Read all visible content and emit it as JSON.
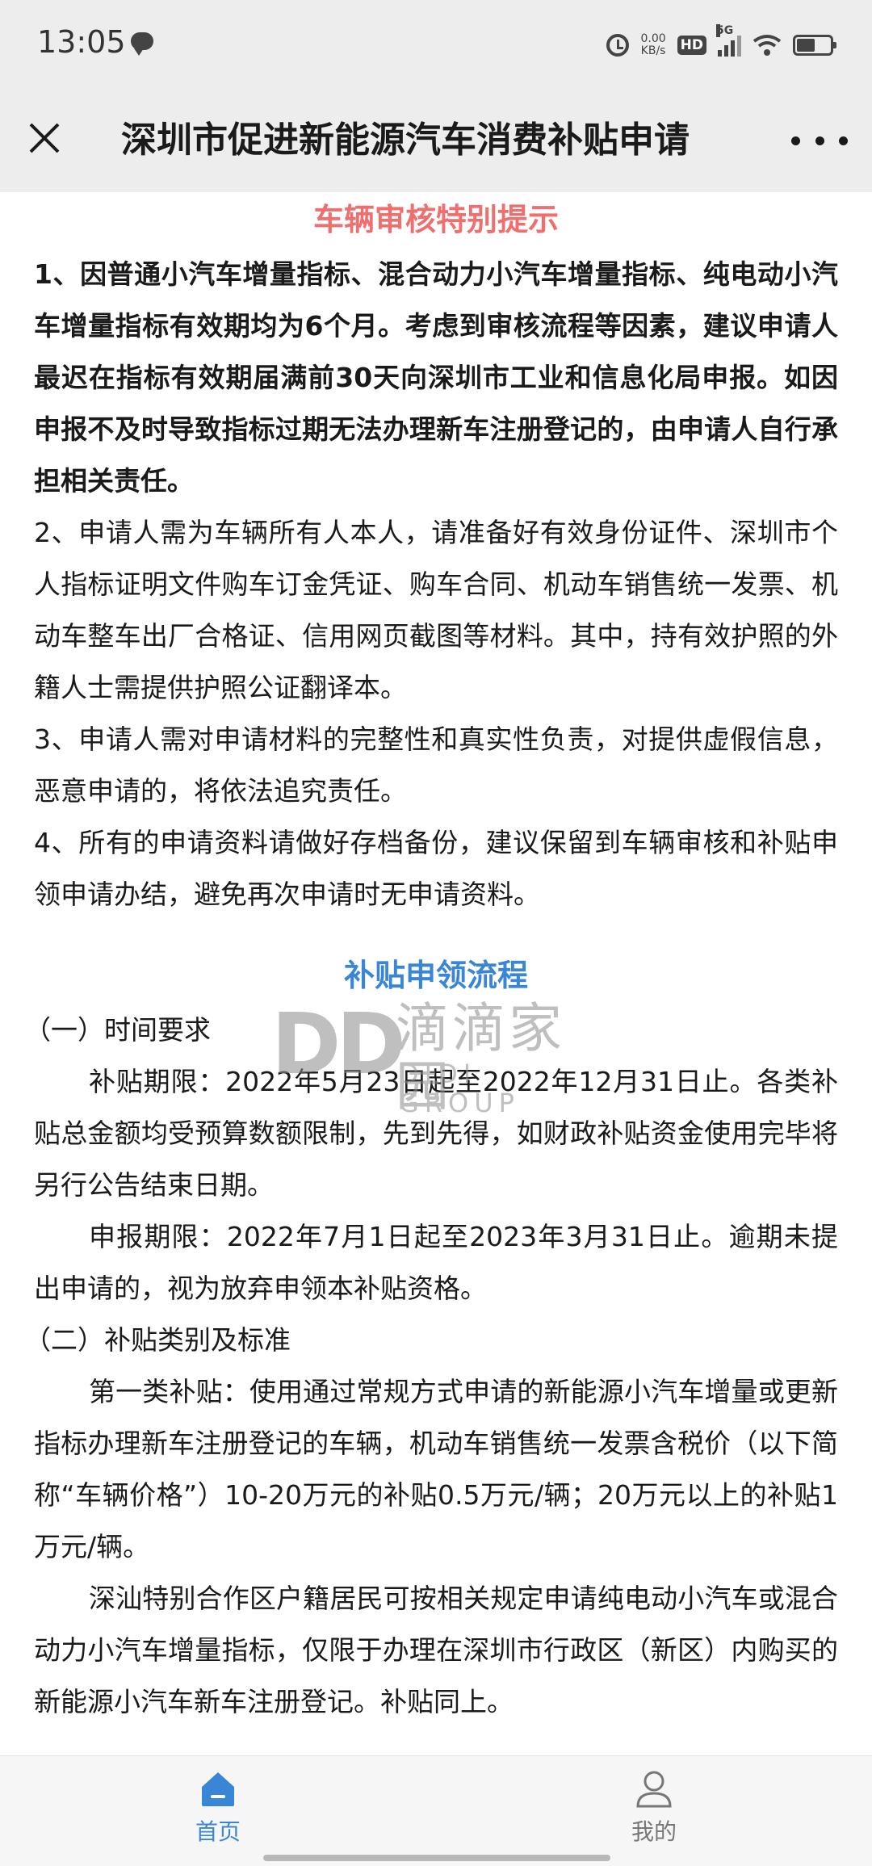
{
  "status_bar": {
    "time": "13:05",
    "net_speed_value": "0.00",
    "net_speed_unit": "KB/s",
    "hd_label": "HD",
    "signal_label": "5G"
  },
  "nav": {
    "title": "深圳市促进新能源汽车消费补贴申请"
  },
  "notice": {
    "title": "车辆审核特别提示",
    "items": [
      "1、因普通小汽车增量指标、混合动力小汽车增量指标、纯电动小汽车增量指标有效期均为6个月。考虑到审核流程等因素，建议申请人最迟在指标有效期届满前30天向深圳市工业和信息化局申报。如因申报不及时导致指标过期无法办理新车注册登记的，由申请人自行承担相关责任。",
      "2、申请人需为车辆所有人本人，请准备好有效身份证件、深圳市个人指标证明文件购车订金凭证、购车合同、机动车销售统一发票、机动车整车出厂合格证、信用网页截图等材料。其中，持有效护照的外籍人士需提供护照公证翻译本。",
      "3、申请人需对申请材料的完整性和真实性负责，对提供虚假信息，恶意申请的，将依法追究责任。",
      "4、所有的申请资料请做好存档备份，建议保留到车辆审核和补贴申领申请办结，避免再次申请时无申请资料。"
    ]
  },
  "process": {
    "title": "补贴申领流程",
    "time_heading": "（一）时间要求",
    "subsidy_period": "补贴期限：2022年5月23日起至2022年12月31日止。各类补贴总金额均受预算数额限制，先到先得，如财政补贴资金使用完毕将另行公告结束日期。",
    "apply_period": "申报期限：2022年7月1日起至2023年3月31日止。逾期未提出申请的，视为放弃申领本补贴资格。",
    "category_heading": "（二）补贴类别及标准",
    "category_1": "第一类补贴：使用通过常规方式申请的新能源小汽车增量或更新指标办理新车注册登记的车辆，机动车销售统一发票含税价（以下简称“车辆价格”）10-20万元的补贴0.5万元/辆；20万元以上的补贴1万元/辆。",
    "shenshan": "深汕特别合作区户籍居民可按相关规定申请纯电动小汽车或混合动力小汽车增量指标，仅限于办理在深圳市行政区（新区）内购买的新能源小汽车新车注册登记。补贴同上。"
  },
  "watermark": {
    "logo": "DD",
    "cn": "滴滴家园",
    "en": "DIDI GROUP"
  },
  "tabs": {
    "home": "首页",
    "mine": "我的"
  },
  "colors": {
    "notice_title": "#ef6f6f",
    "process_title": "#3a86d6",
    "tab_active": "#3a86d6"
  }
}
